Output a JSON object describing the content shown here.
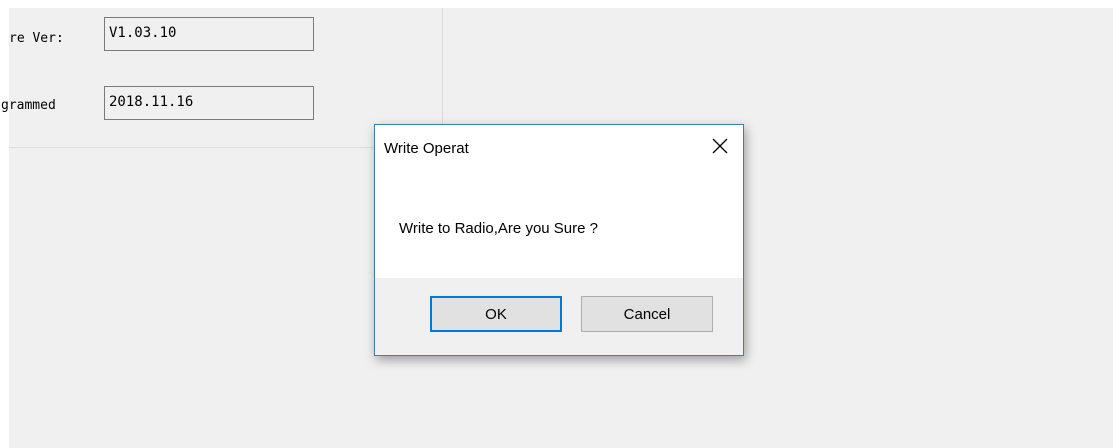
{
  "fields": [
    {
      "label": "re Ver:",
      "value": "V1.03.10"
    },
    {
      "label": "grammed",
      "value": "2018.11.16"
    }
  ],
  "dialog": {
    "title": "Write Operat",
    "message": "Write to Radio,Are you Sure ?",
    "ok_label": "OK",
    "cancel_label": "Cancel",
    "close_icon": "close-icon",
    "border_color": "#3c7fb1",
    "default_button_color": "#0078d7"
  }
}
